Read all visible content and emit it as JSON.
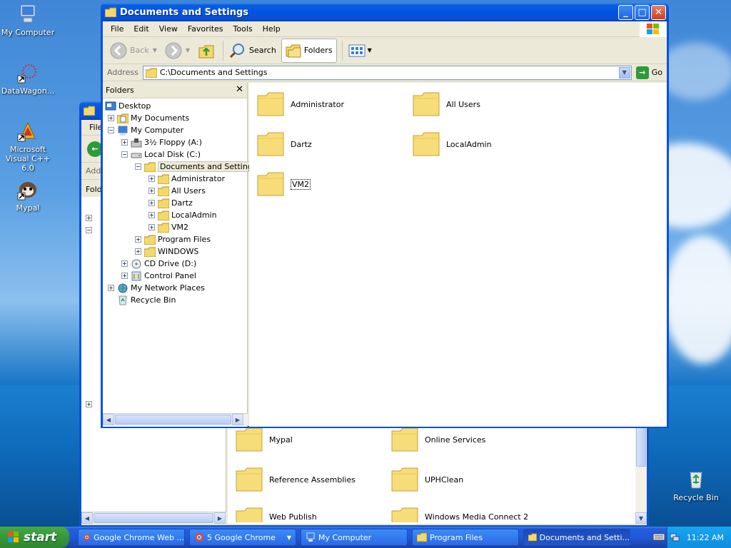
{
  "desktop": {
    "icons": [
      {
        "label": "My Computer"
      },
      {
        "label": "DataWagon..."
      },
      {
        "label": "Microsoft Visual C++ 6.0"
      },
      {
        "label": "Mypal"
      },
      {
        "label": "Recycle Bin"
      }
    ]
  },
  "front_window": {
    "title": "Documents and Settings",
    "menu": [
      "File",
      "Edit",
      "View",
      "Favorites",
      "Tools",
      "Help"
    ],
    "toolbar": {
      "back": "Back",
      "search": "Search",
      "folders": "Folders"
    },
    "address": {
      "label": "Address",
      "value": "C:\\Documents and Settings",
      "go": "Go"
    },
    "folders_pane": {
      "title": "Folders",
      "tree": [
        {
          "label": "Desktop"
        },
        {
          "label": "My Documents"
        },
        {
          "label": "My Computer"
        },
        {
          "label": "3½ Floppy (A:)"
        },
        {
          "label": "Local Disk (C:)"
        },
        {
          "label": "Documents and Settings"
        },
        {
          "label": "Administrator"
        },
        {
          "label": "All Users"
        },
        {
          "label": "Dartz"
        },
        {
          "label": "LocalAdmin"
        },
        {
          "label": "VM2"
        },
        {
          "label": "Program Files"
        },
        {
          "label": "WINDOWS"
        },
        {
          "label": "CD Drive (D:)"
        },
        {
          "label": "Control Panel"
        },
        {
          "label": "My Network Places"
        },
        {
          "label": "Recycle Bin"
        }
      ]
    },
    "contents": [
      "Administrator",
      "All Users",
      "Dartz",
      "LocalAdmin",
      "VM2"
    ]
  },
  "back_window": {
    "menu_first": "File",
    "address_label": "Add",
    "folders_label": "Fold",
    "contents": [
      "Mypal",
      "Online Services",
      "Reference Assemblies",
      "UPHClean",
      "Web Publish",
      "Windows Media Connect 2"
    ]
  },
  "taskbar": {
    "start": "start",
    "tasks": [
      {
        "label": "Google Chrome Web ..."
      },
      {
        "label": "5 Google Chrome"
      },
      {
        "label": "My Computer"
      },
      {
        "label": "Program Files"
      },
      {
        "label": "Documents and Setti..."
      }
    ],
    "clock": "11:22 AM"
  }
}
